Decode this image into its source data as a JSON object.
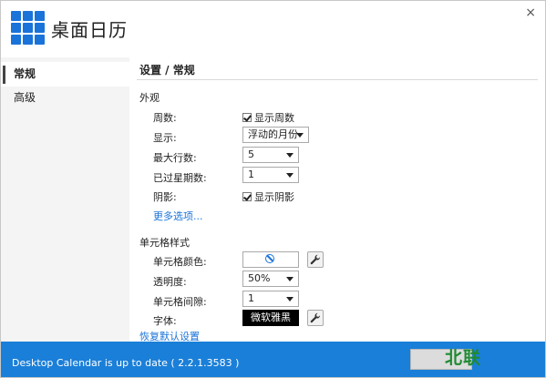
{
  "app": {
    "title": "桌面日历",
    "close_glyph": "×"
  },
  "sidebar": {
    "items": [
      {
        "label": "常规",
        "active": true
      },
      {
        "label": "高级",
        "active": false
      }
    ]
  },
  "page": {
    "title": "设置 / 常规"
  },
  "appearance": {
    "heading": "外观",
    "week_number": {
      "label": "周数:",
      "checkbox_label": "显示周数",
      "checked": true
    },
    "display": {
      "label": "显示:",
      "value": "浮动的月份"
    },
    "max_rows": {
      "label": "最大行数:",
      "value": "5"
    },
    "past_weeks": {
      "label": "已过星期数:",
      "value": "1"
    },
    "shadow": {
      "label": "阴影:",
      "checkbox_label": "显示阴影",
      "checked": true
    },
    "more_options": "更多选项..."
  },
  "cell_style": {
    "heading": "单元格样式",
    "cell_color": {
      "label": "单元格颜色:"
    },
    "transparency": {
      "label": "透明度:",
      "value": "50%"
    },
    "cell_spacing": {
      "label": "单元格间隙:",
      "value": "1"
    },
    "font": {
      "label": "字体:",
      "value": "微软雅黑"
    }
  },
  "restore_defaults": "恢复默认设置",
  "status": {
    "text": "Desktop Calendar is up to date ( 2.2.1.3583 )"
  },
  "watermark": "北联",
  "colors": {
    "accent": "#1a73d9",
    "statusbar": "#1a7fd8",
    "watermark": "#1f8a32"
  }
}
